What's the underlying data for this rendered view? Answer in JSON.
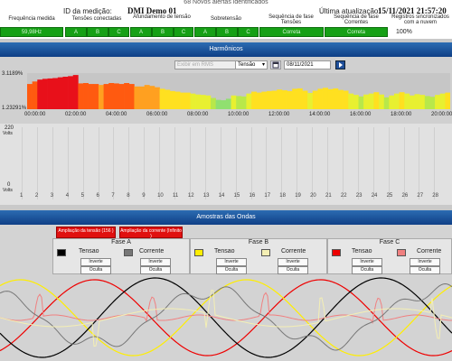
{
  "alert": "68 Novos alertas identificados",
  "header": {
    "id_label": "ID da medição:",
    "device": "DMI Demo 01",
    "update_label": "Última atualização:",
    "update_value": "15/11/2021 21:57:20",
    "col_freq": "Frequência medida",
    "col_volt": "Tensões conectadas",
    "col_afund": "Afundamento de tensão",
    "col_sobre": "Sobretensão",
    "col_seq_v": "Sequência de fase Tensões",
    "col_seq_i": "Sequência de fase Correntes",
    "col_sync": "Registros sincronizados com a nuvem",
    "freq_value": "59,98Hz",
    "phase_a": "A",
    "phase_b": "B",
    "phase_c": "C",
    "seq_v_value": "Correta",
    "seq_i_value": "Correta",
    "sync_value": "100%",
    "ok_color": "#16a016"
  },
  "harmonics": {
    "title": "Harmônicos",
    "mode_placeholder": "Exibir em RMS",
    "measure_value": "Tensão",
    "date_value": "08/11/2021",
    "calendar_icon": "calendar-icon",
    "go_icon": "play-icon",
    "lower_y_top": "220",
    "lower_y_top_unit": "Volts",
    "lower_y_bottom": "0",
    "lower_y_bottom_unit": "Volts",
    "harmonic_orders": [
      "1",
      "2",
      "3",
      "4",
      "5",
      "6",
      "7",
      "8",
      "9",
      "10",
      "11",
      "12",
      "13",
      "14",
      "15",
      "16",
      "17",
      "18",
      "19",
      "20",
      "21",
      "22",
      "23",
      "24",
      "25",
      "26",
      "27",
      "28"
    ]
  },
  "chart_data": {
    "type": "bar",
    "x_ticks": [
      "00:00:00",
      "02:00:00",
      "04:00:00",
      "06:00:00",
      "08:00:00",
      "10:00:00",
      "12:00:00",
      "14:00:00",
      "16:00:00",
      "18:00:00",
      "20:00:00"
    ],
    "y_ticks": [
      "3.1189%",
      "1.23291%"
    ],
    "ylim": [
      1.23291,
      3.1189
    ],
    "values": [
      2.55,
      2.68,
      2.78,
      2.82,
      2.84,
      2.86,
      2.9,
      2.93,
      2.96,
      3.02,
      2.58,
      2.6,
      2.55,
      2.55,
      2.5,
      2.55,
      2.6,
      2.58,
      2.55,
      2.6,
      2.55,
      2.42,
      2.42,
      2.5,
      2.45,
      2.38,
      2.3,
      2.25,
      2.18,
      2.15,
      2.1,
      2.1,
      2.05,
      2.0,
      1.98,
      1.95,
      1.82,
      1.72,
      1.7,
      1.78,
      1.95,
      1.92,
      1.9,
      2.05,
      2.15,
      2.1,
      2.15,
      2.18,
      2.2,
      2.26,
      2.22,
      2.18,
      2.3,
      2.32,
      2.2,
      2.08,
      2.2,
      2.3,
      2.35,
      2.28,
      2.32,
      2.24,
      2.2,
      2.05,
      1.98,
      1.9,
      2.0,
      2.05,
      2.12,
      2.0,
      1.85,
      1.95,
      2.05,
      2.12,
      2.05,
      1.95,
      2.02,
      1.98,
      1.92,
      1.88,
      1.98,
      2.05,
      2.1
    ]
  },
  "waves": {
    "title": "Amostras das Ondas",
    "alarm_v": "Ampliação da tensão (156 )",
    "alarm_i": "Ampliação da corrente (Infinito )",
    "phase_a": "Fase A",
    "phase_b": "Fase B",
    "phase_c": "Fase C",
    "tensao": "Tensao",
    "corrente": "Corrente",
    "inverte": "Inverte",
    "oculta": "Oculta",
    "color_va": "#000000",
    "color_ia": "#777777",
    "color_vb": "#ffee00",
    "color_ib": "#f4efb4",
    "color_vc": "#ee0000",
    "color_ic": "#f08080"
  }
}
